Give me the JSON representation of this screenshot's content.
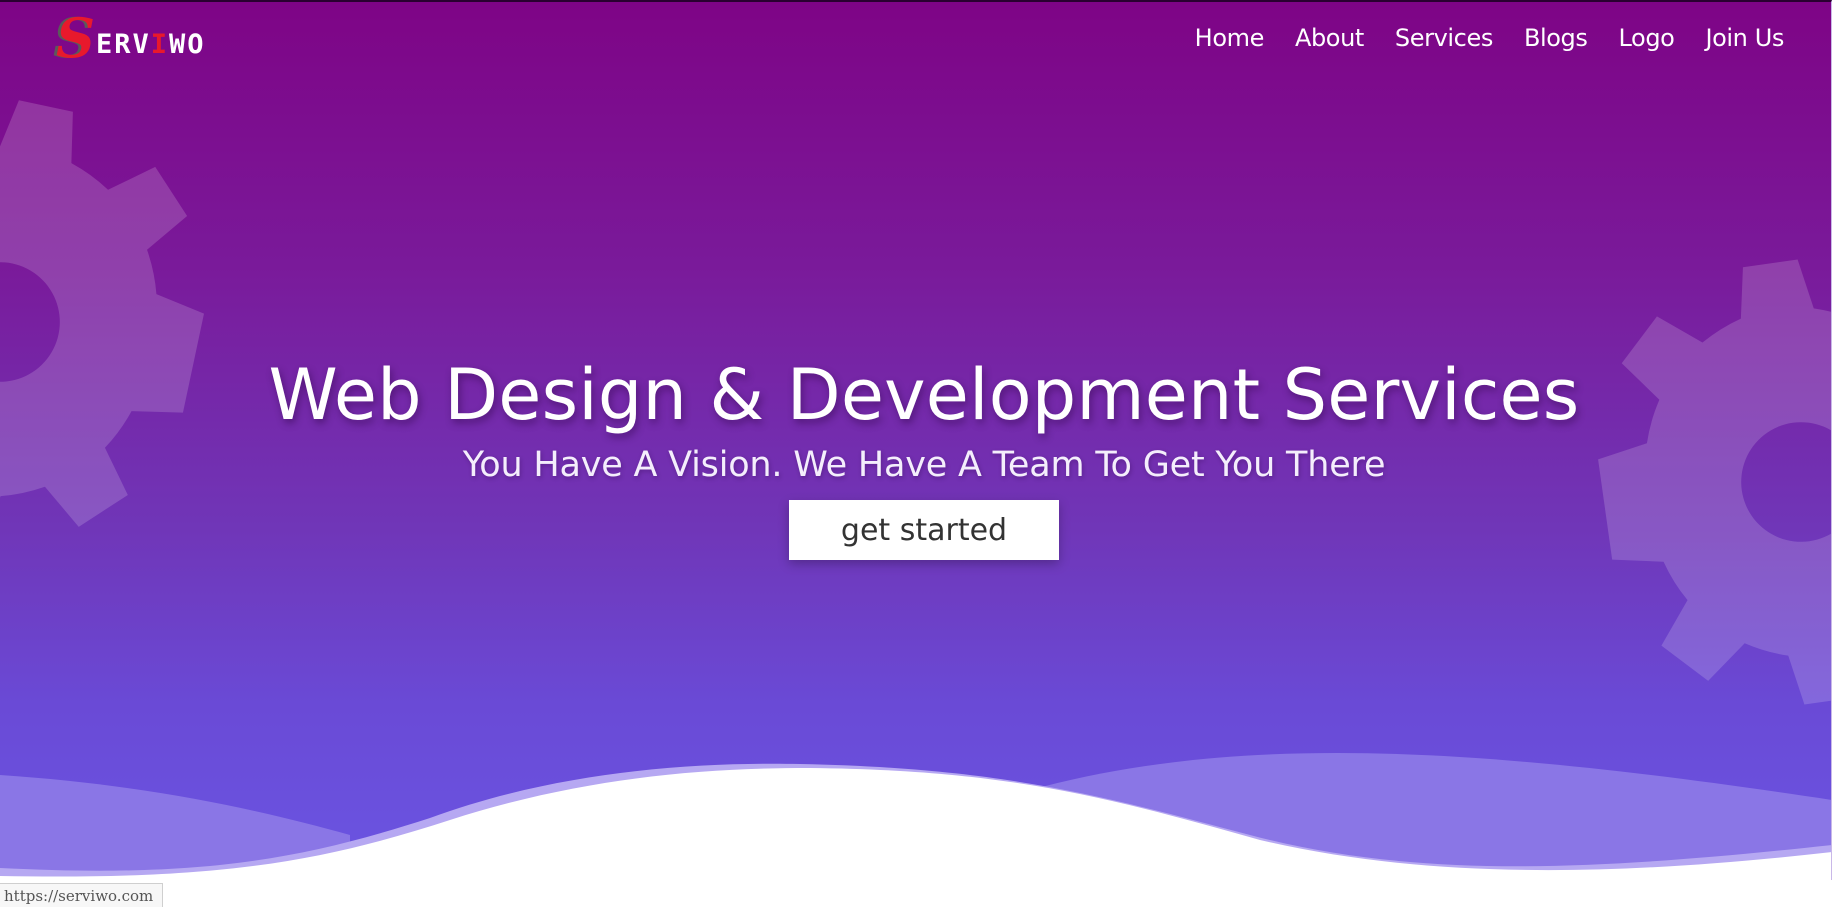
{
  "brand": {
    "logo_initial": "S",
    "logo_text_part1": "ERV",
    "logo_text_accent": "I",
    "logo_text_part2": "WO",
    "accent_color": "#e8192c"
  },
  "nav": {
    "items": [
      {
        "label": "Home"
      },
      {
        "label": "About"
      },
      {
        "label": "Services"
      },
      {
        "label": "Blogs"
      },
      {
        "label": "Logo"
      },
      {
        "label": "Join Us"
      }
    ]
  },
  "hero": {
    "title": "Web Design & Development Services",
    "subtitle": "You Have A Vision. We Have A Team To Get You There",
    "cta_label": "get started",
    "gradient_top": "#7e0486",
    "gradient_bottom": "#6a55e2",
    "decor_icon": "gear-icon"
  },
  "status_bar": {
    "url": "https://serviwo.com"
  }
}
